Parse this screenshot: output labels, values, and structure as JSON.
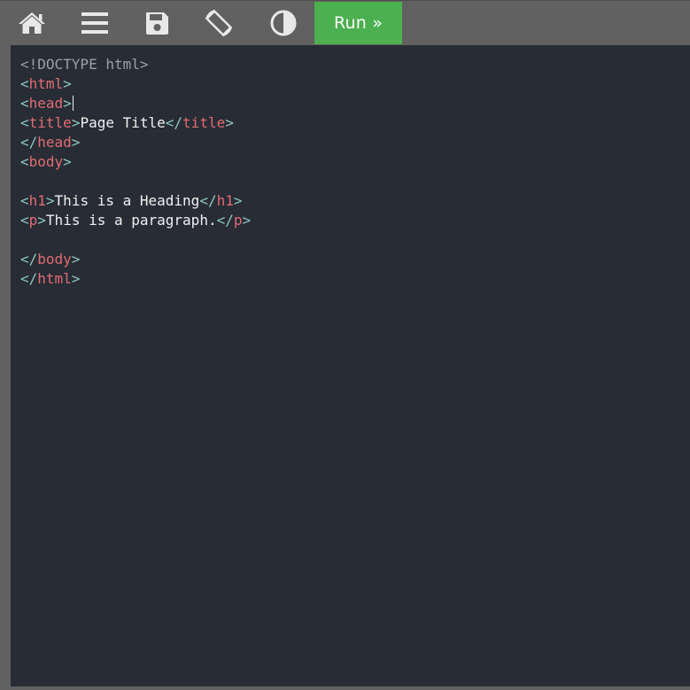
{
  "toolbar": {
    "icons": {
      "home": "home-icon",
      "menu": "menu-icon",
      "save": "save-icon",
      "rotate": "rotate-icon",
      "theme": "contrast-icon"
    },
    "run_label": "Run »"
  },
  "colors": {
    "toolbar_bg": "#616161",
    "run_bg": "#4caf50",
    "editor_bg": "#282c34",
    "tag": "#e06c75",
    "bracket": "#8ec6c5",
    "doctype": "#9aa0a8",
    "text": "#f0f0f0"
  },
  "editor": {
    "lines": [
      "<!DOCTYPE html>",
      "<html>",
      "<head>",
      "<title>Page Title</title>",
      "</head>",
      "<body>",
      "",
      "<h1>This is a Heading</h1>",
      "<p>This is a paragraph.</p>",
      "",
      "</body>",
      "</html>"
    ],
    "cursor_line": 3
  }
}
